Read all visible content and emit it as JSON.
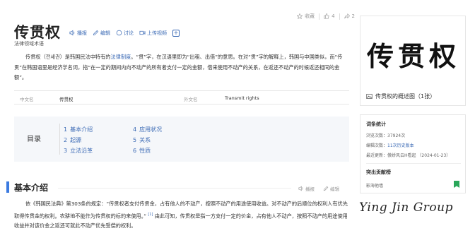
{
  "top_actions": {
    "collect_label": "收藏",
    "like_count": "4",
    "share_count": "2"
  },
  "title": "传贯权",
  "title_tools": {
    "play": "播报",
    "edit": "编辑",
    "discuss": "讨论",
    "upload_video": "上传视频"
  },
  "subtitle": "法律领域术语",
  "summary": {
    "part1": "传贯权（전세권）是韩国民法中特有的",
    "link": "法律制度",
    "part2": "。“贯”字，在汉语里即为“出租、出借”的意思。在对“贯”字的解释上，韩国与中国类似，而“传贯”在韩国语里是经济学名词，指“在一定的期间内向不动产的所有者支付一定的金额，借来使用不动产的关系，在返还不动产的时候返还相同的金额”。"
  },
  "infobox": {
    "cn_name_label": "中文名",
    "cn_name_value": "传贯权",
    "foreign_name_label": "外文名",
    "foreign_name_value": "Transmit rights"
  },
  "toc": {
    "title": "目录",
    "items": [
      {
        "num": "1",
        "label": "基本介绍"
      },
      {
        "num": "2",
        "label": "起源"
      },
      {
        "num": "3",
        "label": "立法沿革"
      },
      {
        "num": "4",
        "label": "应用状况"
      },
      {
        "num": "5",
        "label": "关系"
      },
      {
        "num": "6",
        "label": "性质"
      }
    ]
  },
  "section": {
    "title": "基本介绍",
    "play": "播报",
    "edit": "编辑",
    "text1": "依《韩国民法典》第303条的规定：“传贯权者支付传贯金，占有他人的不动产，按照不动产的用途使用收益。对不动产的后顺位的权利人有优先取得传贯金的权利。农耕地不能作为传贯权的标的来使用。”",
    "ref": "[1]",
    "text2": "由此可知，传贯权是指一方支付一定的价金，占有他人不动产，按照不动产的用途使用收益并对该价金之返还可就此不动产优先受偿的权利。"
  },
  "album": {
    "image_text": "传贯权",
    "caption": "传贯权的概述图（1张）"
  },
  "stats": {
    "heading": "词条统计",
    "views_label": "浏览次数：",
    "views_value": "37924次",
    "edits_label": "编辑次数：",
    "edits_value": "11次历史版本",
    "updated_label": "最近更新：",
    "updated_value": "傲娇风云H看起 （2024-01-23）",
    "contrib_heading": "突出贡献榜",
    "contrib_user": "影海他墙"
  },
  "watermark": "Ying Jin Group",
  "colors": {
    "link": "#3b6ab5",
    "accent_bar": "#3b7ae0",
    "toc_bg": "#f5f7fa",
    "badge": "#2aa75a"
  }
}
